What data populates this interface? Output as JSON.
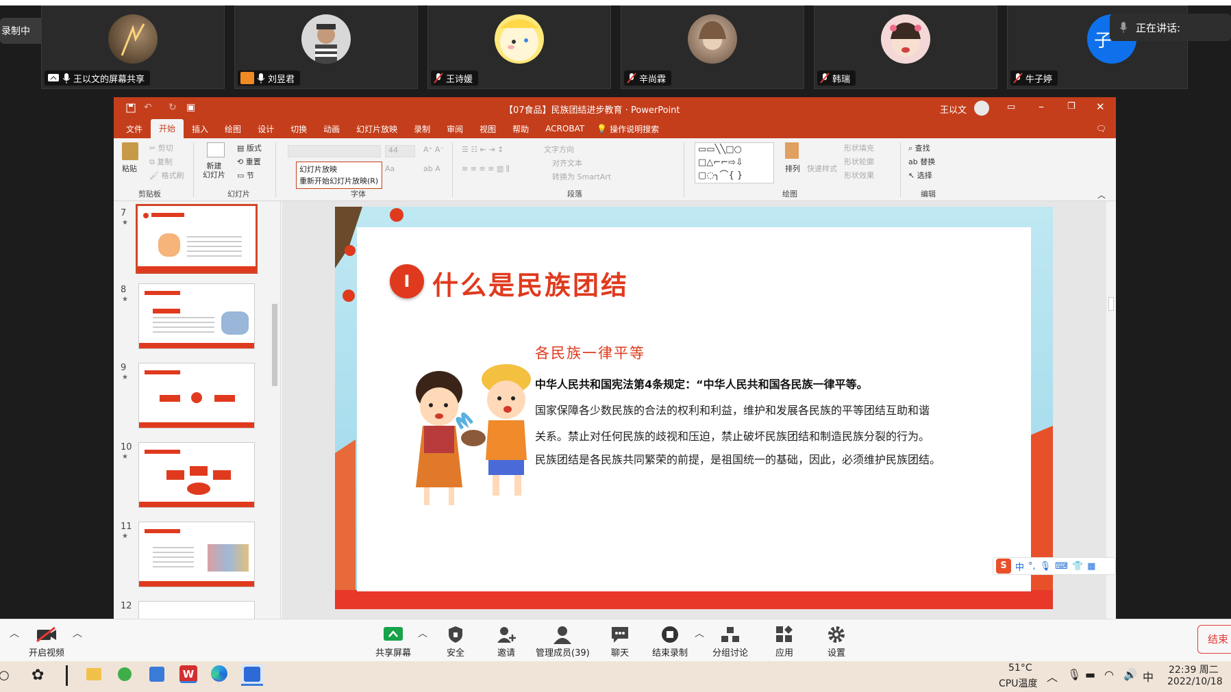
{
  "recording": {
    "label": "录制中"
  },
  "speaking": {
    "label": "正在讲话:"
  },
  "participants": [
    {
      "name": "王以文的屏幕共享"
    },
    {
      "name": "刘昱君"
    },
    {
      "name": "王诗媛"
    },
    {
      "name": "辛尚霖"
    },
    {
      "name": "韩瑞"
    },
    {
      "name": "牛子婷",
      "initial": "子"
    }
  ],
  "ppt": {
    "title": "【07食品】民族团结进步教育 · PowerPoint",
    "user": "王以文",
    "menu": [
      "文件",
      "开始",
      "插入",
      "绘图",
      "设计",
      "切换",
      "动画",
      "幻灯片放映",
      "录制",
      "审阅",
      "视图",
      "帮助",
      "ACROBAT",
      "操作说明搜索"
    ],
    "ribbon": {
      "paste": "粘贴",
      "cut": "剪切",
      "copy": "复制",
      "format_painter": "格式刷",
      "clipboard": "剪贴板",
      "new_slide": "新建\n幻灯片",
      "layout": "版式",
      "reset": "重置",
      "section": "节",
      "slides": "幻灯片",
      "font_size": "44",
      "font": "字体",
      "text_dir": "文字方向",
      "align_text": "对齐文本",
      "smartart": "转换为 SmartArt",
      "paragraph": "段落",
      "arrange": "排列",
      "quick_styles": "快速样式",
      "shape_fill": "形状填充",
      "shape_outline": "形状轮廓",
      "shape_effects": "形状效果",
      "drawing": "绘图",
      "find": "查找",
      "replace": "替换",
      "select": "选择",
      "editing": "编辑",
      "tooltip_title": "幻灯片放映",
      "tooltip_item": "重新开始幻灯片放映(R)"
    },
    "thumbs": [
      {
        "num": "7",
        "star": "★"
      },
      {
        "num": "8",
        "star": "★"
      },
      {
        "num": "9",
        "star": "★"
      },
      {
        "num": "10",
        "star": "★"
      },
      {
        "num": "11",
        "star": "★"
      },
      {
        "num": "12",
        "star": ""
      }
    ]
  },
  "slide": {
    "badge": "I",
    "title": "什么是民族团结",
    "subtitle": "各民族一律平等",
    "bold_line": "中华人民共和国宪法第4条规定：“中华人民共和国各民族一律平等。",
    "line1": "国家保障各少数民族的合法的权利和利益，维护和发展各民族的平等团结互助和谐",
    "line2": "关系。禁止对任何民族的歧视和压迫，禁止破坏民族团结和制造民族分裂的行为。",
    "line3": "民族团结是各民族共同繁荣的前提，是祖国统一的基础，因此，必须维护民族团结。",
    "ime": [
      "中",
      "°,"
    ]
  },
  "zoom": {
    "video": "开启视频",
    "share": "共享屏幕",
    "security": "安全",
    "invite": "邀请",
    "members": "管理成员(39)",
    "chat": "聊天",
    "stop_rec": "结束录制",
    "breakout": "分组讨论",
    "apps": "应用",
    "settings": "设置",
    "end": "结束"
  },
  "taskbar": {
    "temp": "51°C",
    "temp_label": "CPU温度",
    "ime": "中",
    "time": "22:39 周二",
    "date": "2022/10/18"
  },
  "colors": {
    "ppt_red": "#c43e1c",
    "slide_red": "#e03a1e",
    "zoom_blue": "#0e71eb"
  }
}
